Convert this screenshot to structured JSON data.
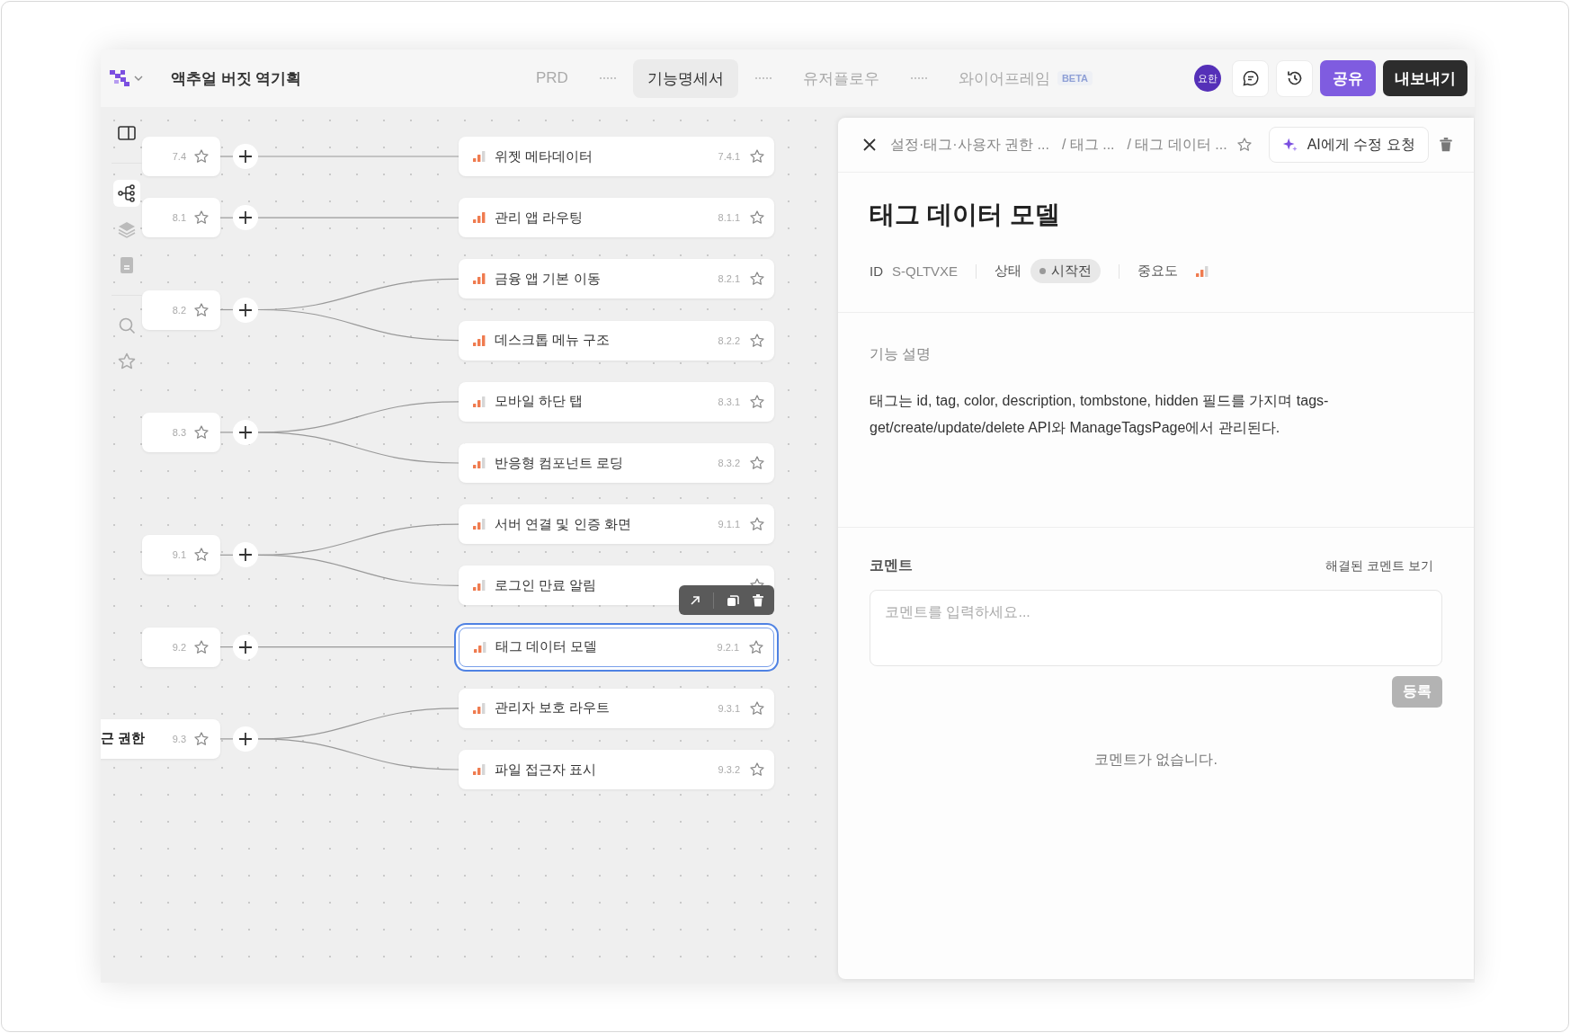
{
  "header": {
    "project_title": "액추얼 버짓 역기획",
    "tabs": [
      {
        "label": "PRD",
        "selected": false
      },
      {
        "label": "기능명세서",
        "selected": true
      },
      {
        "label": "유저플로우",
        "selected": false
      },
      {
        "label": "와이어프레임",
        "selected": false,
        "badge": "BETA"
      }
    ],
    "avatar": "요한",
    "share_button": "공유",
    "export_button": "내보내기"
  },
  "toolbar": [
    {
      "kind": "panel",
      "selected": false
    },
    {
      "kind": "tree",
      "selected": true
    },
    {
      "kind": "layers",
      "selected": false
    },
    {
      "kind": "document",
      "selected": false
    },
    {
      "kind": "search",
      "selected": false
    },
    {
      "kind": "star",
      "selected": false
    }
  ],
  "canvas": {
    "nodes": [
      {
        "number": "7.4",
        "children": [
          {
            "label": "위젯 메타데이터",
            "number": "7.4.1",
            "level": 0.67,
            "selected": false,
            "hovered": false
          }
        ]
      },
      {
        "number": "8.1",
        "children": [
          {
            "label": "관리 앱 라우팅",
            "number": "8.1.1",
            "level": 1,
            "selected": false,
            "hovered": false
          }
        ]
      },
      {
        "number": "8.2",
        "children": [
          {
            "label": "금융 앱 기본 이동",
            "number": "8.2.1",
            "level": 1,
            "selected": false,
            "hovered": false
          },
          {
            "label": "데스크톱 메뉴 구조",
            "number": "8.2.2",
            "level": 1,
            "selected": false,
            "hovered": false
          }
        ]
      },
      {
        "number": "8.3",
        "children": [
          {
            "label": "모바일 하단 탭",
            "number": "8.3.1",
            "level": 0.67,
            "selected": false,
            "hovered": false
          },
          {
            "label": "반응형 컴포넌트 로딩",
            "number": "8.3.2",
            "level": 0.67,
            "selected": false,
            "hovered": false
          }
        ]
      },
      {
        "number": "9.1",
        "children": [
          {
            "label": "서버 연결 및 인증 화면",
            "number": "9.1.1",
            "level": 0.67,
            "selected": false,
            "hovered": false
          },
          {
            "label": "로그인 만료 알림",
            "level": 0.67,
            "selected": false,
            "hovered": true
          }
        ]
      },
      {
        "number": "9.2",
        "children": [
          {
            "label": "태그 데이터 모델",
            "number": "9.2.1",
            "level": 0.67,
            "selected": true,
            "hovered": false
          }
        ]
      },
      {
        "label": "근 권한",
        "number": "9.3",
        "children": [
          {
            "label": "관리자 보호 라우트",
            "number": "9.3.1",
            "level": 0.67,
            "selected": false,
            "hovered": false
          },
          {
            "label": "파일 접근자 표시",
            "number": "9.3.2",
            "level": 0.67,
            "selected": false,
            "hovered": false
          }
        ]
      }
    ]
  },
  "detail_panel": {
    "breadcrumbs": [
      "설정·태그·사용자 권한 ...",
      "/ 태그 ...",
      "/ 태그 데이터 ..."
    ],
    "ai_button": "AI에게 수정 요청",
    "title": "태그 데이터 모델",
    "id_label": "ID",
    "id_value": "S-QLTVXE",
    "status_label": "상태",
    "status": "시작전",
    "priority_label": "중요도",
    "priority": {
      "level": 0.67
    },
    "description_label": "기능 설명",
    "description": "태그는 id, tag, color, description, tombstone, hidden 필드를 가지며 tags-get/create/update/delete API와 ManageTagsPage에서 관리된다.",
    "comments_label": "코멘트",
    "resolved_link": "해결된 코멘트 보기",
    "comment_placeholder": "코멘트를 입력하세요...",
    "submit_button": {
      "label": "등록",
      "disabled": true
    },
    "empty_message": "코멘트가 없습니다."
  }
}
